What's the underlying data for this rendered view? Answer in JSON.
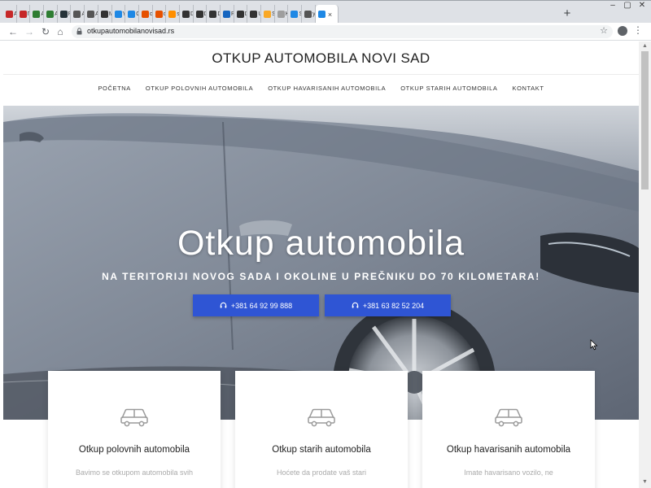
{
  "browser": {
    "tabs": [
      {
        "title": "A",
        "color": "#c62828"
      },
      {
        "title": "П",
        "color": "#c62828"
      },
      {
        "title": "A",
        "color": "#2e7d32"
      },
      {
        "title": "A",
        "color": "#2e7d32"
      },
      {
        "title": "R",
        "color": "#263238"
      },
      {
        "title": "A",
        "color": "#555555"
      },
      {
        "title": "A",
        "color": "#555555"
      },
      {
        "title": "M",
        "color": "#333333"
      },
      {
        "title": "Y",
        "color": "#1e88e5"
      },
      {
        "title": "C",
        "color": "#1e88e5"
      },
      {
        "title": "cl",
        "color": "#e65100"
      },
      {
        "title": "cl",
        "color": "#e65100"
      },
      {
        "title": "su",
        "color": "#ff8f00"
      },
      {
        "title": "D",
        "color": "#333333"
      },
      {
        "title": "D",
        "color": "#333333"
      },
      {
        "title": "D",
        "color": "#333333"
      },
      {
        "title": "R",
        "color": "#1565c0"
      },
      {
        "title": "D",
        "color": "#333333"
      },
      {
        "title": "U",
        "color": "#333333"
      },
      {
        "title": "S",
        "color": "#f9a825"
      },
      {
        "title": "K",
        "color": "#9e9e9e"
      },
      {
        "title": "S",
        "color": "#1e88e5"
      },
      {
        "title": "y",
        "color": "#555555"
      }
    ],
    "active_tab_close": "×",
    "new_tab": "+",
    "url": "otkupautomobilanovisad.rs"
  },
  "site": {
    "title": "OTKUP AUTOMOBILA NOVI SAD",
    "nav": [
      "POČETNA",
      "OTKUP POLOVNIH AUTOMOBILA",
      "OTKUP HAVARISANIH AUTOMOBILA",
      "OTKUP STARIH AUTOMOBILA",
      "KONTAKT"
    ]
  },
  "hero": {
    "title": "Otkup automobila",
    "subtitle": "NA TERITORIJI NOVOG SADA I OKOLINE U PREČNIKU DO 70 KILOMETARA!",
    "phone1": "+381 64 92 99 888",
    "phone2": "+381 63 82 52 204",
    "button_color": "#2f55d4"
  },
  "cards": [
    {
      "title": "Otkup polovnih automobila",
      "desc": "Bavimo se otkupom automobila svih"
    },
    {
      "title": "Otkup starih automobila",
      "desc": "Hoćete da prodate vaš stari"
    },
    {
      "title": "Otkup havarisanih automobila",
      "desc": "Imate havarisano vozilo, ne"
    }
  ]
}
